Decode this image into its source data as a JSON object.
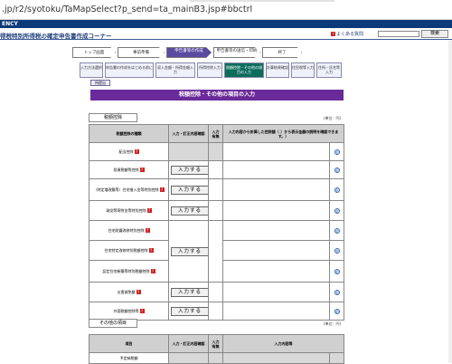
{
  "browser": {
    "url": ".jp/r2/syotoku/TaMapSelect?p_send=ta_mainB3.jsp#bbctrl"
  },
  "band": {
    "text": "ENCY"
  },
  "header": {
    "title": "得税特別所得税の確定申告書作成コーナー",
    "help_label": "よくある質問",
    "search_label": "検索"
  },
  "steps": [
    {
      "label": "トップ画面"
    },
    {
      "label": "事前準備"
    },
    {
      "label": "申告書等の作成",
      "active": true
    },
    {
      "label": "申告書等の送信・印刷",
      "active": true
    },
    {
      "label": "終了"
    }
  ],
  "substeps": [
    {
      "label": "入力方法選択"
    },
    {
      "label": "申告書の作成をはじめる前に"
    },
    {
      "label": "収入金額・所得金額入力"
    },
    {
      "label": "所得控除入力"
    },
    {
      "label": "税額控除・その他の項目の入力"
    },
    {
      "label": "計算結果確認"
    },
    {
      "label": "住民税等入力"
    },
    {
      "label": "住所・氏名等入力"
    }
  ],
  "teishutsu": "所提出",
  "section_title": "税額控除・その他の項目の入力",
  "tax_credit": {
    "label": "税額控除",
    "unit": "(単位：円)",
    "headers": [
      "税額控除の種類",
      "入力・訂正内容確認",
      "入力有無",
      "入力内容から計算した控除額（ ）から表示金額の説明を確認できます。）"
    ],
    "input_label": "入力する",
    "rows": [
      {
        "name": "配当控除"
      },
      {
        "name": "投資税額等控除"
      },
      {
        "name": "（特定増改築等）住宅借入金等特別控除"
      },
      {
        "name": "政党等寄附金等特別控除"
      },
      {
        "name": "住宅耐震改修特別控除"
      },
      {
        "name": "住宅特定改修特別税額控除"
      },
      {
        "name": "認定住宅新築等特別税額控除"
      },
      {
        "name": "災害減免額"
      },
      {
        "name": "外国税額控除等"
      }
    ]
  },
  "other": {
    "label": "その他の項目",
    "unit": "(単位：円)",
    "headers": [
      "項目",
      "入力・訂正内容確認",
      "入力有無",
      "入力内容等"
    ],
    "rows": [
      {
        "name": "予定納税額"
      }
    ]
  }
}
